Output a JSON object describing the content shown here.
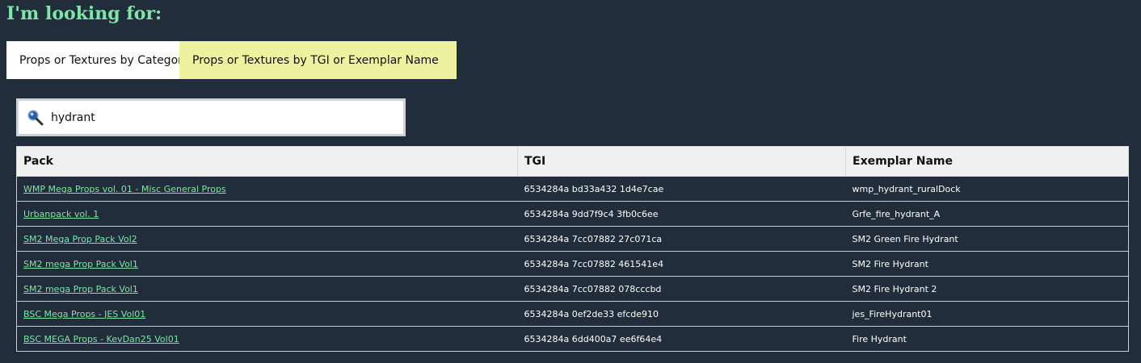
{
  "heading": "I'm looking for:",
  "tabs": [
    {
      "label": "Props or Textures by Category"
    },
    {
      "label": "Props or Textures by TGI or Exemplar Name"
    }
  ],
  "search": {
    "value": "hydrant",
    "icon": "search-icon"
  },
  "table": {
    "headers": {
      "pack": "Pack",
      "tgi": "TGI",
      "exemplar": "Exemplar Name"
    },
    "rows": [
      {
        "pack": "WMP Mega Props vol. 01 - Misc General Props",
        "tgi": "6534284a bd33a432 1d4e7cae",
        "exemplar": "wmp_hydrant_ruralDock"
      },
      {
        "pack": "Urbanpack vol. 1",
        "tgi": "6534284a 9dd7f9c4 3fb0c6ee",
        "exemplar": "Grfe_fire_hydrant_A"
      },
      {
        "pack": "SM2 Mega Prop Pack Vol2",
        "tgi": "6534284a 7cc07882 27c071ca",
        "exemplar": "SM2 Green Fire Hydrant"
      },
      {
        "pack": "SM2 mega Prop Pack Vol1",
        "tgi": "6534284a 7cc07882 461541e4",
        "exemplar": "SM2 Fire Hydrant"
      },
      {
        "pack": "SM2 mega Prop Pack Vol1",
        "tgi": "6534284a 7cc07882 078cccbd",
        "exemplar": "SM2 Fire Hydrant 2"
      },
      {
        "pack": "BSC Mega Props - JES Vol01",
        "tgi": "6534284a 0ef2de33 efcde910",
        "exemplar": "jes_FireHydrant01"
      },
      {
        "pack": "BSC MEGA Props - KevDan25 Vol01",
        "tgi": "6534284a 6dd400a7 ee6f64e4",
        "exemplar": "Fire Hydrant"
      }
    ]
  },
  "colors": {
    "background": "#212d3a",
    "heading": "#7fe6a8",
    "link": "#7fe6a8",
    "active_tab": "#eef29e",
    "inactive_tab": "#ffffff",
    "header_row": "#f0f0f0"
  }
}
